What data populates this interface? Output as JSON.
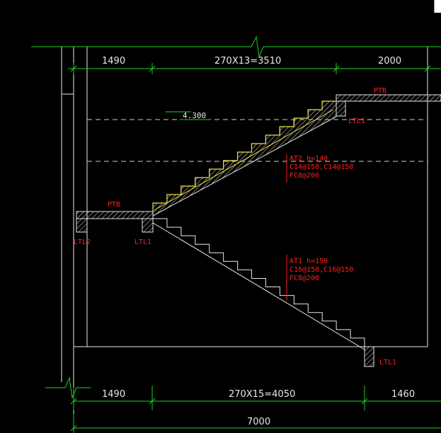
{
  "dimensions": {
    "top": [
      "1490",
      "270X13=3510",
      "2000"
    ],
    "bottom": [
      "1490",
      "270X15=4050",
      "1460"
    ],
    "total": "7000"
  },
  "elevation": "4.300",
  "labels": {
    "ptb_upper": "PTB",
    "ptb_lower": "PTB",
    "ltl1_upper": "LTL1",
    "ltl1_mid": "LTL1",
    "ltl1_bottom": "LTL1",
    "ltl2": "LTL2"
  },
  "flights": {
    "at2": [
      "AT2  h=140",
      "C14@150,C14@150",
      "FC8@200"
    ],
    "at1": [
      "AT1  h=150",
      "C16@150,C16@150",
      "FC8@200"
    ]
  }
}
